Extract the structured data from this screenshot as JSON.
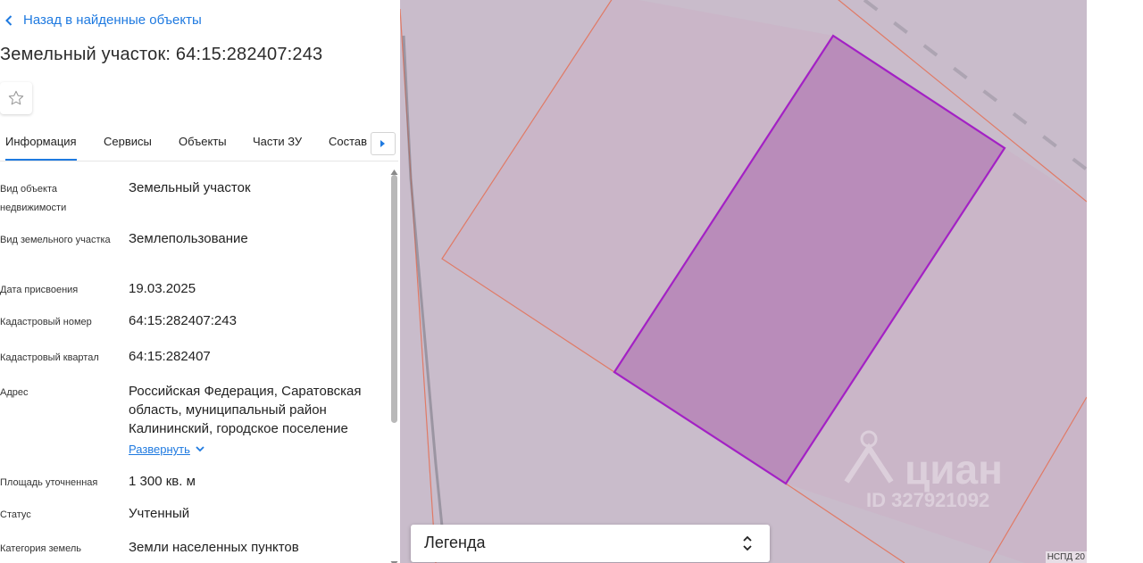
{
  "back_link": "Назад в найденные объекты",
  "title": "Земельный участок: 64:15:282407:243",
  "tabs": [
    {
      "label": "Информация"
    },
    {
      "label": "Сервисы"
    },
    {
      "label": "Объекты"
    },
    {
      "label": "Части ЗУ"
    },
    {
      "label": "Состав"
    }
  ],
  "rows": [
    {
      "label": "Вид объекта недвижимости",
      "value": "Земельный участок"
    },
    {
      "label": "Вид земельного участка",
      "value": "Землепользование"
    },
    {
      "label": "Дата присвоения",
      "value": "19.03.2025"
    },
    {
      "label": "Кадастровый номер",
      "value": "64:15:282407:243"
    },
    {
      "label": "Кадастровый квартал",
      "value": "64:15:282407"
    },
    {
      "label": "Адрес",
      "value": "Российская Федерация, Саратовская область, муниципальный район Калининский, городское поселение",
      "expand": "Развернуть"
    },
    {
      "label": "Площадь уточненная",
      "value": "1 300 кв. м"
    },
    {
      "label": "Статус",
      "value": "Учтенный"
    },
    {
      "label": "Категория земель",
      "value": "Земли населенных пунктов"
    }
  ],
  "map": {
    "legend_label": "Легенда",
    "watermark_brand": "циан",
    "watermark_id": "ID 327921092",
    "scale_label": "НСПД 20",
    "colors": {
      "background": "#c9bccb",
      "parcel_fill": "#b98cba",
      "parcel_stroke": "#a321c4",
      "neighbor_stroke": "#e07a66"
    }
  }
}
